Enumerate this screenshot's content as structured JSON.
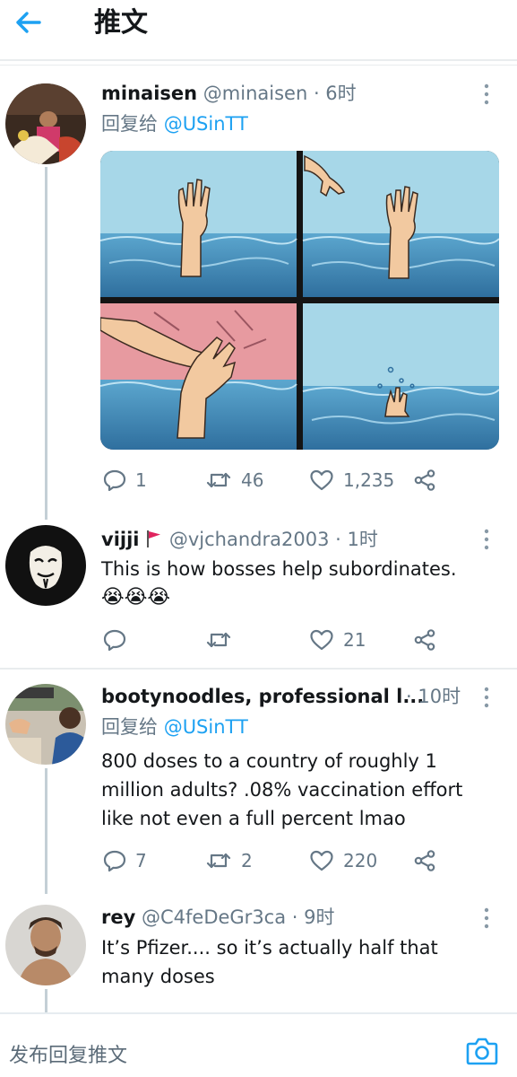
{
  "header": {
    "title": "推文"
  },
  "tweets": [
    {
      "name": "minaisen",
      "handle": "@minaisen",
      "time": "· 6时",
      "reply_prefix": "回复给",
      "reply_to": "@USinTT",
      "counts": {
        "reply": "1",
        "retweet": "46",
        "like": "1,235"
      }
    },
    {
      "name": "vijji",
      "handle": "@vjchandra2003",
      "time": "· 1时",
      "text": "This is how bosses help subordinates.",
      "emoji": "😭😭😭",
      "counts": {
        "reply": "",
        "retweet": "",
        "like": "21"
      }
    },
    {
      "name": "bootynoodles, professional l...",
      "handle": "",
      "time": "· 10时",
      "reply_prefix": "回复给",
      "reply_to": "@USinTT",
      "text": "800 doses to a country of roughly 1 million adults? .08% vaccination effort like not even a full percent lmao",
      "counts": {
        "reply": "7",
        "retweet": "2",
        "like": "220"
      }
    },
    {
      "name": "rey",
      "handle": "@C4feDeGr3ca",
      "time": "· 9时",
      "text": "It’s Pfizer.... so it’s actually half that many doses"
    }
  ],
  "compose": {
    "placeholder": "发布回复推文"
  },
  "colors": {
    "accent": "#1da1f2",
    "muted": "#657786",
    "text": "#14171a",
    "divider": "#e9ecee"
  },
  "icons": [
    "back-arrow-icon",
    "reply-icon",
    "retweet-icon",
    "like-icon",
    "share-icon",
    "more-icon",
    "camera-icon",
    "flag-icon"
  ]
}
